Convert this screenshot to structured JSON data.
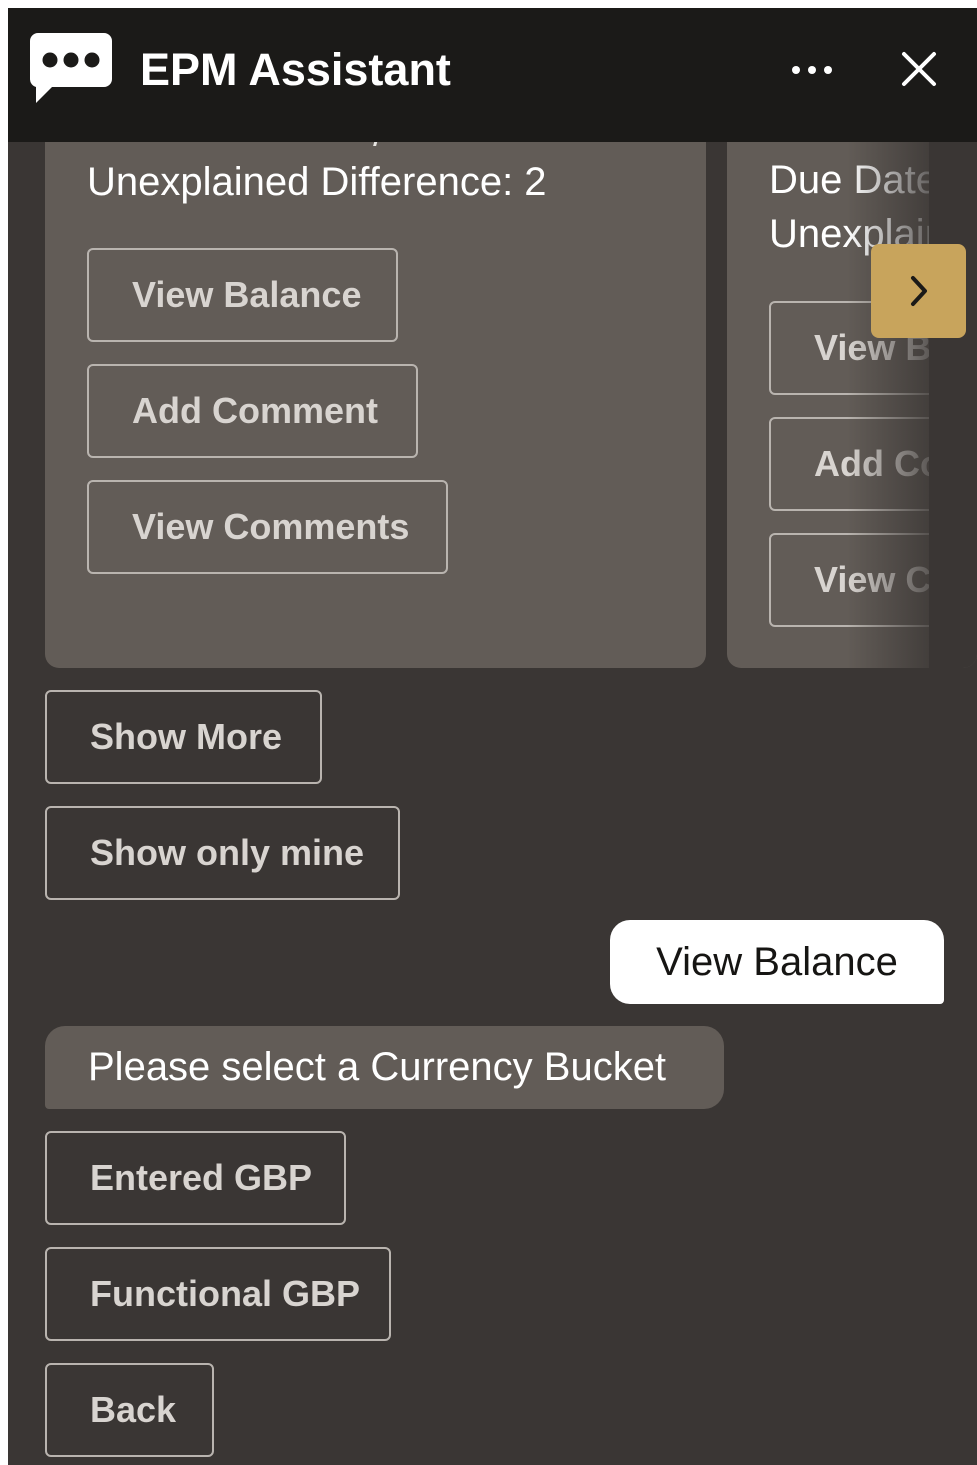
{
  "header": {
    "title": "EPM Assistant",
    "bg_color": "#1b1a18",
    "icons": {
      "logo": "chat-bubble-icon",
      "more": "more-horizontal-icon",
      "close": "close-icon"
    }
  },
  "carousel": {
    "card1": {
      "line": "Unexplained Difference: 2",
      "actions": [
        "View Balance",
        "Add Comment",
        "View Comments"
      ]
    },
    "card2": {
      "line1": "Due Date",
      "line2": "Unexplained",
      "actions": [
        "View Balance",
        "Add Comment",
        "View Comments"
      ]
    },
    "next_icon": "chevron-right-icon",
    "next_color": "#c8a45c"
  },
  "list_actions": [
    "Show More",
    "Show only mine"
  ],
  "user_message": "View Balance",
  "bot_message": "Please select a Currency Bucket",
  "currency_options": [
    "Entered GBP",
    "Functional GBP",
    "Back"
  ],
  "colors": {
    "chat_bg": "#3a3634",
    "card_bg": "#625c57",
    "button_border": "#b9b4af"
  }
}
